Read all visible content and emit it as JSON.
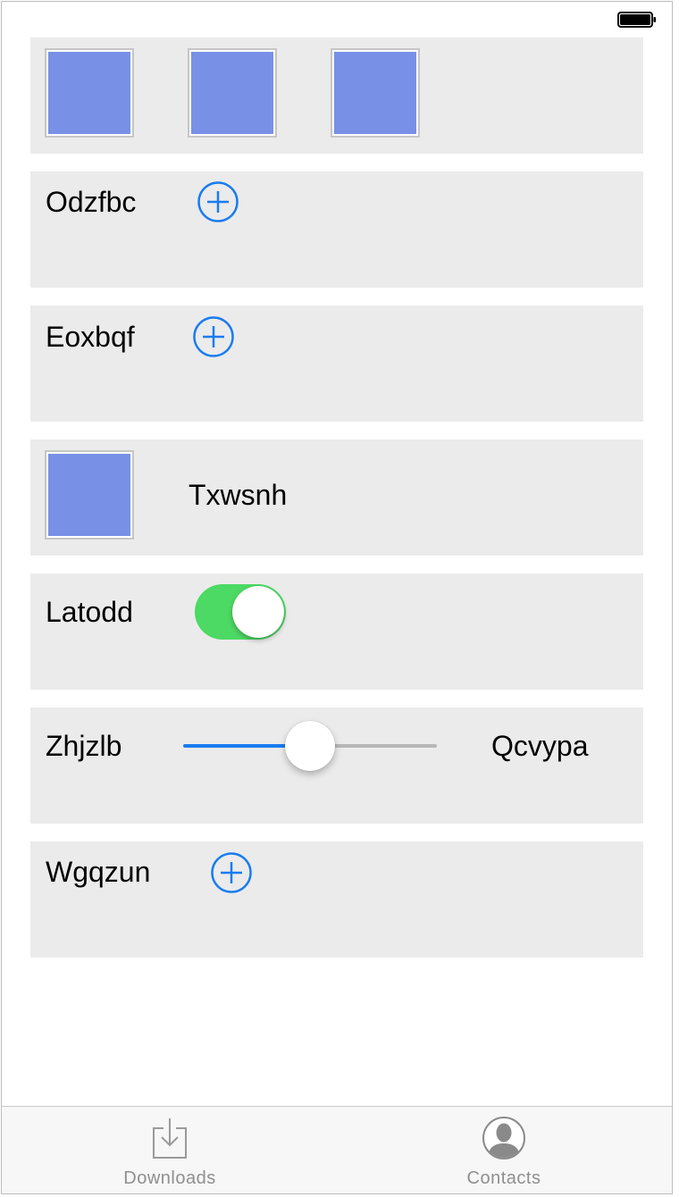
{
  "colors": {
    "accent": "#1a7cf0",
    "toggle_on": "#4cd964",
    "thumbnail_fill": "#7890e6",
    "panel_bg": "#ebebeb",
    "tab_label": "#8f8f8f"
  },
  "status_bar": {
    "battery_icon": "battery-icon"
  },
  "rows": {
    "odzfbc": {
      "label": "Odzfbc",
      "icon": "plus-circle-icon"
    },
    "eoxbqf": {
      "label": "Eoxbqf",
      "icon": "plus-circle-icon"
    },
    "txwsnh": {
      "label": "Txwsnh"
    },
    "latodd": {
      "label": "Latodd",
      "toggle_on": true
    },
    "zhjzlb": {
      "label": "Zhjzlb",
      "value_label": "Qcvypa",
      "slider_value": 0.5
    },
    "wgqzun": {
      "label": "Wgqzun",
      "icon": "plus-circle-icon"
    }
  },
  "tab_bar": {
    "tabs": [
      {
        "label": "Downloads",
        "icon": "download-tray-icon"
      },
      {
        "label": "Contacts",
        "icon": "person-circle-icon"
      }
    ]
  }
}
